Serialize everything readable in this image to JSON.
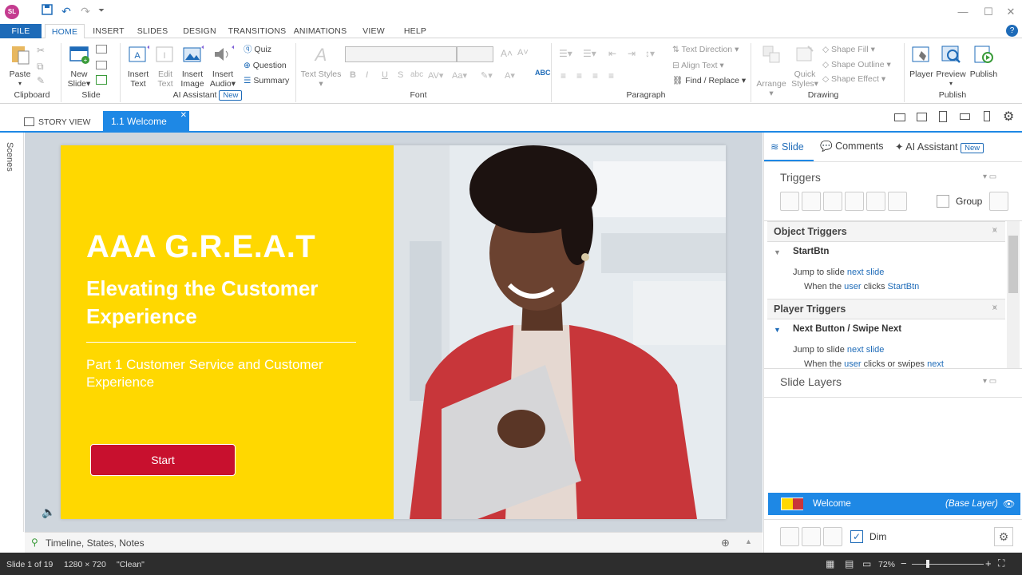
{
  "app": {
    "logo_text": "SL"
  },
  "ribbon_tabs": [
    "FILE",
    "HOME",
    "INSERT",
    "SLIDES",
    "DESIGN",
    "TRANSITIONS",
    "ANIMATIONS",
    "VIEW",
    "HELP"
  ],
  "ribbon": {
    "clipboard": {
      "paste": "Paste",
      "label": "Clipboard"
    },
    "slide": {
      "new_slide_1": "New",
      "new_slide_2": "Slide",
      "label": "Slide"
    },
    "ai": {
      "insert_text_1": "Insert",
      "insert_text_2": "Text",
      "edit_text_1": "Edit",
      "edit_text_2": "Text",
      "insert_image_1": "Insert",
      "insert_image_2": "Image",
      "insert_audio_1": "Insert",
      "insert_audio_2": "Audio",
      "quiz": "Quiz",
      "question": "Question",
      "summary": "Summary",
      "label": "AI Assistant",
      "badge": "New"
    },
    "font": {
      "text_styles": "Text Styles",
      "label": "Font"
    },
    "paragraph": {
      "text_direction": "Text Direction",
      "align_text": "Align Text",
      "find_replace": "Find / Replace",
      "label": "Paragraph"
    },
    "drawing": {
      "arrange": "Arrange",
      "quick_styles_1": "Quick",
      "quick_styles_2": "Styles",
      "shape_fill": "Shape Fill",
      "shape_outline": "Shape Outline",
      "shape_effect": "Shape Effect",
      "label": "Drawing"
    },
    "publish": {
      "player": "Player",
      "preview": "Preview",
      "publish": "Publish",
      "label": "Publish"
    }
  },
  "doc_tabs": {
    "story_view": "STORY VIEW",
    "current": "1.1 Welcome"
  },
  "scenes_label": "Scenes",
  "slide": {
    "title": "AAA G.R.E.A.T",
    "subtitle": "Elevating the Customer Experience",
    "part": "Part 1 Customer Service and Customer Experience",
    "start_button": "Start",
    "colors": {
      "background": "#ffd800",
      "button": "#c8102e"
    }
  },
  "timeline_label": "Timeline, States, Notes",
  "right_panel": {
    "tabs": {
      "slide": "Slide",
      "comments": "Comments",
      "ai": "AI Assistant",
      "ai_badge": "New"
    },
    "triggers_title": "Triggers",
    "group_label": "Group",
    "object_triggers": {
      "header": "Object Triggers",
      "name": "StartBtn",
      "line1_a": "Jump to slide ",
      "line1_b": "next slide",
      "line2_a": "When the ",
      "line2_b": "user",
      "line2_c": " clicks ",
      "line2_d": "StartBtn"
    },
    "player_triggers": {
      "header": "Player Triggers",
      "name": "Next Button / Swipe Next",
      "line1_a": "Jump to slide ",
      "line1_b": "next slide",
      "line2_a": "When the ",
      "line2_b": "user",
      "line2_c": " clicks or swipes ",
      "line2_d": "next"
    },
    "layers_title": "Slide Layers",
    "layer": {
      "name": "Welcome",
      "tag": "(Base Layer)"
    },
    "dim_label": "Dim"
  },
  "status": {
    "slide": "Slide 1 of 19",
    "size": "1280 × 720",
    "theme": "\"Clean\"",
    "zoom": "72%"
  }
}
